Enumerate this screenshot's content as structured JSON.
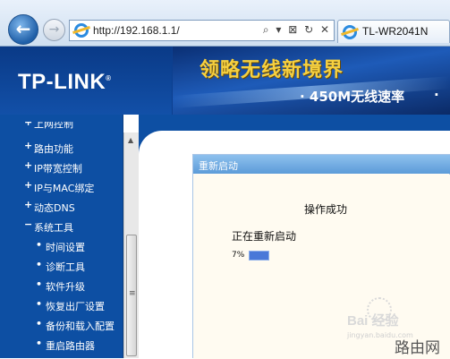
{
  "browser": {
    "url": "http://192.168.1.1/",
    "tab_title": "TL-WR2041N",
    "address_tools": "⌕ ▾ ⊠ ↻ ✕"
  },
  "banner": {
    "logo": "TP-LINK",
    "logo_mark": "®",
    "slogan": "领略无线新境界",
    "speed": "· 450M无线速率",
    "trailing_dot": "·"
  },
  "sidebar": {
    "items": [
      {
        "bullet": "+",
        "label": "上网控制",
        "level": 0,
        "clipped": true
      },
      {
        "bullet": "+",
        "label": "路由功能",
        "level": 0
      },
      {
        "bullet": "+",
        "label": "IP带宽控制",
        "level": 0
      },
      {
        "bullet": "+",
        "label": "IP与MAC绑定",
        "level": 0
      },
      {
        "bullet": "+",
        "label": "动态DNS",
        "level": 0
      },
      {
        "bullet": "−",
        "label": "系统工具",
        "level": 0
      },
      {
        "bullet": "•",
        "label": "时间设置",
        "level": 1
      },
      {
        "bullet": "•",
        "label": "诊断工具",
        "level": 1
      },
      {
        "bullet": "•",
        "label": "软件升级",
        "level": 1
      },
      {
        "bullet": "•",
        "label": "恢复出厂设置",
        "level": 1
      },
      {
        "bullet": "•",
        "label": "备份和载入配置",
        "level": 1
      },
      {
        "bullet": "•",
        "label": "重启路由器",
        "level": 1
      }
    ]
  },
  "dialog": {
    "title": "重新启动",
    "success": "操作成功",
    "restarting": "正在重新启动",
    "progress_label": "7%",
    "progress_fraction": 0.07
  },
  "watermark": {
    "brand": "Bai",
    "brand_cn": "经验",
    "sub": "jingyan.baidu.com",
    "site": "路由网"
  },
  "colors": {
    "sidebar_bg": "#0d4fa3",
    "dialog_title": "#6fa9e2",
    "progress": "#4a78d8",
    "slogan": "#f6d040"
  }
}
